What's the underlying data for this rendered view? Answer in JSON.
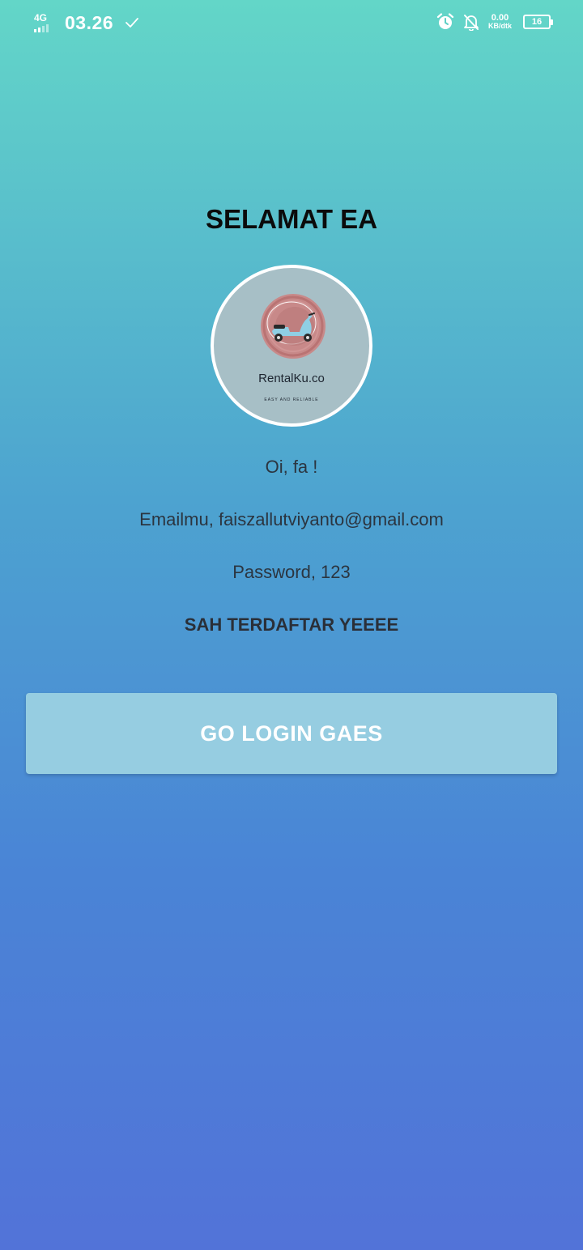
{
  "status_bar": {
    "network": "4G",
    "time": "03.26",
    "speed_value": "0.00",
    "speed_unit": "KB/dtk",
    "battery": "16",
    "icons": [
      "signal-icon",
      "check-icon",
      "alarm-icon",
      "notifications-off-icon",
      "battery-icon"
    ]
  },
  "main": {
    "title": "SELAMAT EA",
    "logo": {
      "name": "RentalKu.co",
      "tagline": "EASY AND RELIABLE",
      "icon": "scooter-icon"
    },
    "greeting": "Oi, fa !",
    "email": "Emailmu, faiszallutviyanto@gmail.com",
    "password": "Password, 123",
    "status": "SAH TERDAFTAR YEEEE",
    "login_button": "GO LOGIN GAES"
  },
  "colors": {
    "gradient_top": "#63d6c8",
    "gradient_bottom": "#5273d8",
    "button": "#96cde1",
    "logo_background": "#a7bfc6"
  }
}
